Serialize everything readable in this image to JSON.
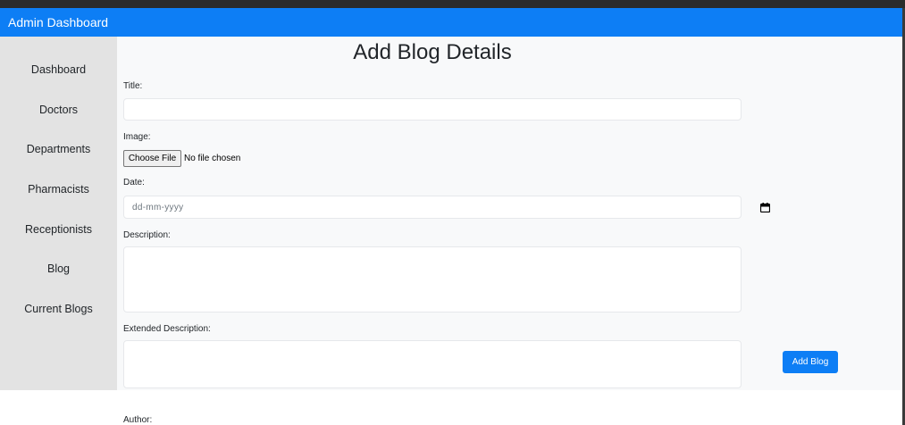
{
  "header": {
    "title": "Admin Dashboard"
  },
  "sidebar": {
    "items": [
      {
        "label": "Dashboard"
      },
      {
        "label": "Doctors"
      },
      {
        "label": "Departments"
      },
      {
        "label": "Pharmacists"
      },
      {
        "label": "Receptionists"
      },
      {
        "label": "Blog"
      },
      {
        "label": "Current Blogs"
      }
    ]
  },
  "form": {
    "heading": "Add Blog Details",
    "title_label": "Title:",
    "title_value": "",
    "image_label": "Image:",
    "choose_file_label": "Choose File",
    "no_file_text": "No file chosen",
    "date_label": "Date:",
    "date_placeholder": "dd-mm-yyyy",
    "description_label": "Description:",
    "description_value": "",
    "extended_description_label": "Extended Description:",
    "extended_description_value": "",
    "author_label": "Author:",
    "submit_label": "Add Blog"
  },
  "icons": {
    "calendar": "calendar-icon"
  },
  "colors": {
    "accent": "#0d7ef5",
    "sidebar_bg": "#e3e3e3",
    "main_bg": "#f8f9fa"
  }
}
